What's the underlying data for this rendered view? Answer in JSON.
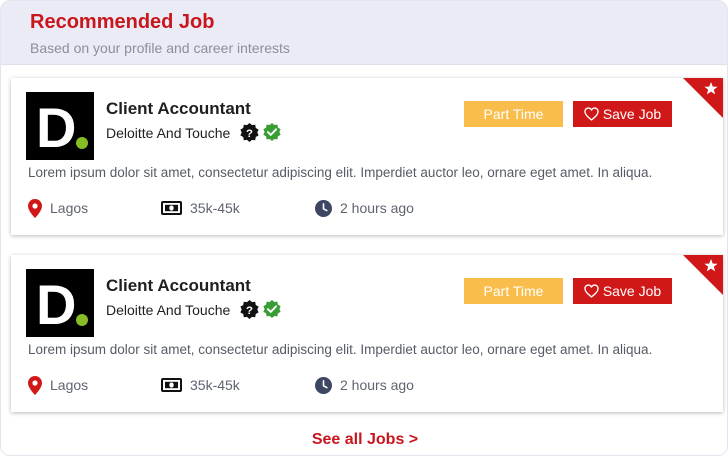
{
  "section": {
    "title": "Recommended Job",
    "subtitle": "Based on your profile and career interests",
    "see_all_label": "See all Jobs >"
  },
  "jobs": [
    {
      "title": "Client Accountant",
      "company": "Deloitte And Touche",
      "logo_letter": "D",
      "type": "Part Time",
      "save_label": "Save Job",
      "description": "Lorem ipsum dolor sit amet, consectetur adipiscing elit. Imperdiet auctor leo, ornare eget amet. In aliqua.",
      "location": "Lagos",
      "salary": "35k-45k",
      "posted": "2 hours ago"
    },
    {
      "title": "Client Accountant",
      "company": "Deloitte And Touche",
      "logo_letter": "D",
      "type": "Part Time",
      "save_label": "Save Job",
      "description": "Lorem ipsum dolor sit amet, consectetur adipiscing elit. Imperdiet auctor leo, ornare eget amet. In aliqua.",
      "location": "Lagos",
      "salary": "35k-45k",
      "posted": "2 hours ago"
    }
  ],
  "icons": {
    "featured": "star-icon",
    "help": "question-badge-icon",
    "verified": "verified-check-icon",
    "save": "heart-icon",
    "location": "map-pin-icon",
    "salary": "banknote-icon",
    "time": "clock-icon"
  },
  "colors": {
    "brand_red": "#c8161d",
    "button_red": "#d01818",
    "badge_yellow": "#f9bd4c",
    "logo_dot_green": "#86bc25",
    "verified_green": "#3a9c35",
    "header_bg": "#ebebf5"
  }
}
